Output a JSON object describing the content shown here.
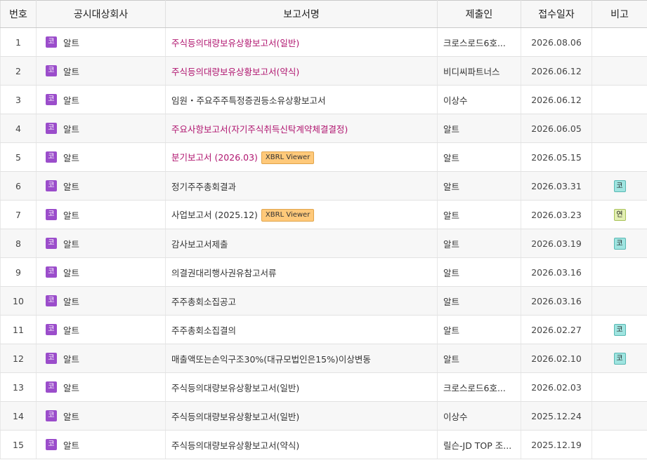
{
  "table": {
    "headers": {
      "no": "번호",
      "company": "공시대상회사",
      "report": "보고서명",
      "submitter": "제출인",
      "date": "접수일자",
      "remark": "비고"
    },
    "rows": [
      {
        "no": "1",
        "market": "코",
        "company": "알트",
        "report": "주식등의대량보유상황보고서(일반)",
        "highlight": true,
        "xbrl": "",
        "submitter": "크로스로드6호...",
        "date": "2026.08.06",
        "remark": ""
      },
      {
        "no": "2",
        "market": "코",
        "company": "알트",
        "report": "주식등의대량보유상황보고서(약식)",
        "highlight": true,
        "xbrl": "",
        "submitter": "비디씨파트너스",
        "date": "2026.06.12",
        "remark": ""
      },
      {
        "no": "3",
        "market": "코",
        "company": "알트",
        "report": "임원・주요주주특정증권등소유상황보고서",
        "highlight": false,
        "xbrl": "",
        "submitter": "이상수",
        "date": "2026.06.12",
        "remark": ""
      },
      {
        "no": "4",
        "market": "코",
        "company": "알트",
        "report": "주요사항보고서(자기주식취득신탁계약체결결정)",
        "highlight": true,
        "xbrl": "",
        "submitter": "알트",
        "date": "2026.06.05",
        "remark": ""
      },
      {
        "no": "5",
        "market": "코",
        "company": "알트",
        "report": "분기보고서 (2026.03)",
        "highlight": true,
        "xbrl": "XBRL Viewer",
        "submitter": "알트",
        "date": "2026.05.15",
        "remark": ""
      },
      {
        "no": "6",
        "market": "코",
        "company": "알트",
        "report": "정기주주총회결과",
        "highlight": false,
        "xbrl": "",
        "submitter": "알트",
        "date": "2026.03.31",
        "remark": "코"
      },
      {
        "no": "7",
        "market": "코",
        "company": "알트",
        "report": "사업보고서 (2025.12)",
        "highlight": false,
        "xbrl": "XBRL Viewer",
        "submitter": "알트",
        "date": "2026.03.23",
        "remark": "연"
      },
      {
        "no": "8",
        "market": "코",
        "company": "알트",
        "report": "감사보고서제출",
        "highlight": false,
        "xbrl": "",
        "submitter": "알트",
        "date": "2026.03.19",
        "remark": "코"
      },
      {
        "no": "9",
        "market": "코",
        "company": "알트",
        "report": "의결권대리행사권유참고서류",
        "highlight": false,
        "xbrl": "",
        "submitter": "알트",
        "date": "2026.03.16",
        "remark": ""
      },
      {
        "no": "10",
        "market": "코",
        "company": "알트",
        "report": "주주총회소집공고",
        "highlight": false,
        "xbrl": "",
        "submitter": "알트",
        "date": "2026.03.16",
        "remark": ""
      },
      {
        "no": "11",
        "market": "코",
        "company": "알트",
        "report": "주주총회소집결의",
        "highlight": false,
        "xbrl": "",
        "submitter": "알트",
        "date": "2026.02.27",
        "remark": "코"
      },
      {
        "no": "12",
        "market": "코",
        "company": "알트",
        "report": "매출액또는손익구조30%(대규모법인은15%)이상변동",
        "highlight": false,
        "xbrl": "",
        "submitter": "알트",
        "date": "2026.02.10",
        "remark": "코"
      },
      {
        "no": "13",
        "market": "코",
        "company": "알트",
        "report": "주식등의대량보유상황보고서(일반)",
        "highlight": false,
        "xbrl": "",
        "submitter": "크로스로드6호...",
        "date": "2026.02.03",
        "remark": ""
      },
      {
        "no": "14",
        "market": "코",
        "company": "알트",
        "report": "주식등의대량보유상황보고서(일반)",
        "highlight": false,
        "xbrl": "",
        "submitter": "이상수",
        "date": "2025.12.24",
        "remark": ""
      },
      {
        "no": "15",
        "market": "코",
        "company": "알트",
        "report": "주식등의대량보유상황보고서(약식)",
        "highlight": false,
        "xbrl": "",
        "submitter": "릴슨-JD TOP 조...",
        "date": "2025.12.19",
        "remark": ""
      }
    ]
  },
  "colors": {
    "highlight_text": "#b0156f",
    "market_badge": "#9b4dcb",
    "xbrl_badge": "#ffc97a",
    "remark_ko": "#9fe4e0",
    "remark_yeon": "#e2efb2"
  }
}
